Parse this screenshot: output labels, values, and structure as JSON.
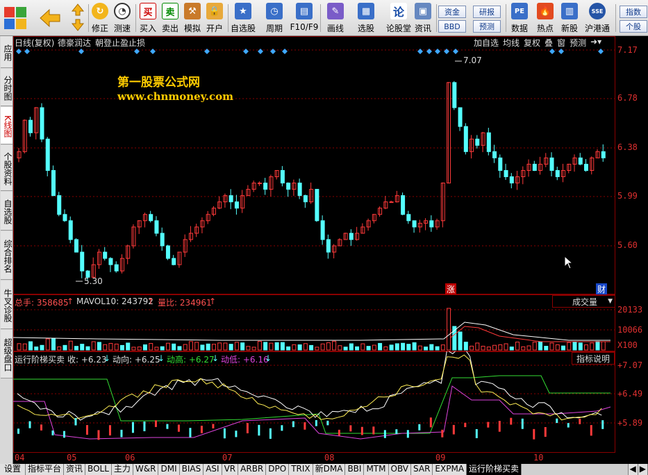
{
  "toolbar": {
    "buttons": [
      {
        "label": "",
        "icon": "windows-logo-icon"
      },
      {
        "label": "",
        "icon": "back-arrow-icon"
      },
      {
        "label": "",
        "icon": "up-down-arrows-icon"
      },
      {
        "label": "修正",
        "icon": "fix-icon"
      },
      {
        "label": "测速",
        "icon": "speedtest-icon"
      },
      {
        "label": "买入",
        "icon": "buy-icon"
      },
      {
        "label": "卖出",
        "icon": "sell-icon"
      },
      {
        "label": "模拟",
        "icon": "hammer-icon"
      },
      {
        "label": "开户",
        "icon": "lock-icon"
      },
      {
        "label": "自选股",
        "icon": "star-list-icon"
      },
      {
        "label": "周期",
        "icon": "clock-cycle-icon"
      },
      {
        "label": "F10/F9",
        "icon": "f10-icon"
      },
      {
        "label": "画线",
        "icon": "pencil-icon"
      },
      {
        "label": "选股",
        "icon": "select-stock-icon"
      },
      {
        "label": "论股堂",
        "icon": "forum-icon"
      },
      {
        "label": "资讯",
        "icon": "news-icon"
      },
      {
        "label": "数据",
        "icon": "pe-data-icon"
      },
      {
        "label": "热点",
        "icon": "hot-icon"
      },
      {
        "label": "新股",
        "icon": "new-stock-icon"
      },
      {
        "label": "沪港通",
        "icon": "hk-connect-icon"
      }
    ],
    "small_buttons": [
      "资金",
      "BBD",
      "研报",
      "预测",
      "指数",
      "个股"
    ]
  },
  "left_tabs": [
    "应用",
    "分时图",
    "K线图",
    "个股资料",
    "自选股",
    "综合排名",
    "牛叉诊股",
    "超级盘口"
  ],
  "main_chart": {
    "title": "日线(复权)",
    "stock_name": "德豪润达",
    "strategy": "朝登止盈止损",
    "overlay_buttons": [
      "加自选",
      "均线",
      "复权",
      "叠",
      "窗",
      "预测"
    ],
    "watermark_cn": "第一股票公式网",
    "watermark_url": "www.chnmoney.com",
    "y_ticks": [
      "7.17",
      "6.78",
      "6.38",
      "5.99",
      "5.60"
    ],
    "high_label": "7.07",
    "low_label": "5.30",
    "markers": [
      "涨",
      "财"
    ]
  },
  "volume_chart": {
    "label_total": "总手: 358685",
    "label_mavol": "MAVOL10: 243792",
    "label_ratio": "量比: 234961",
    "dropdown": "成交量",
    "y_ticks": [
      "20133",
      "10066",
      "X100"
    ]
  },
  "indicator_chart": {
    "title": "运行阶梯买卖",
    "label_close": "收: +6.23",
    "label_direction": "动向: +6.25",
    "label_high": "动高: +6.27",
    "label_low": "动低: +6.16",
    "help_button": "指标说明",
    "y_ticks": [
      "+7.07",
      "+6.49",
      "+5.89"
    ]
  },
  "x_axis": [
    "04",
    "05",
    "06",
    "07",
    "08",
    "09",
    "10"
  ],
  "bottom_tabs": [
    "设置",
    "指标平台",
    "资讯",
    "BOLL",
    "主力",
    "W&R",
    "DMI",
    "BIAS",
    "ASI",
    "VR",
    "ARBR",
    "DPO",
    "TRIX",
    "新DMA",
    "BBI",
    "MTM",
    "OBV",
    "SAR",
    "EXPMA",
    "运行阶梯买卖"
  ],
  "colors": {
    "up": "#ff3a3a",
    "down": "#54ffff",
    "grid": "#8a0000",
    "accent_yellow": "#ffcc00"
  }
}
